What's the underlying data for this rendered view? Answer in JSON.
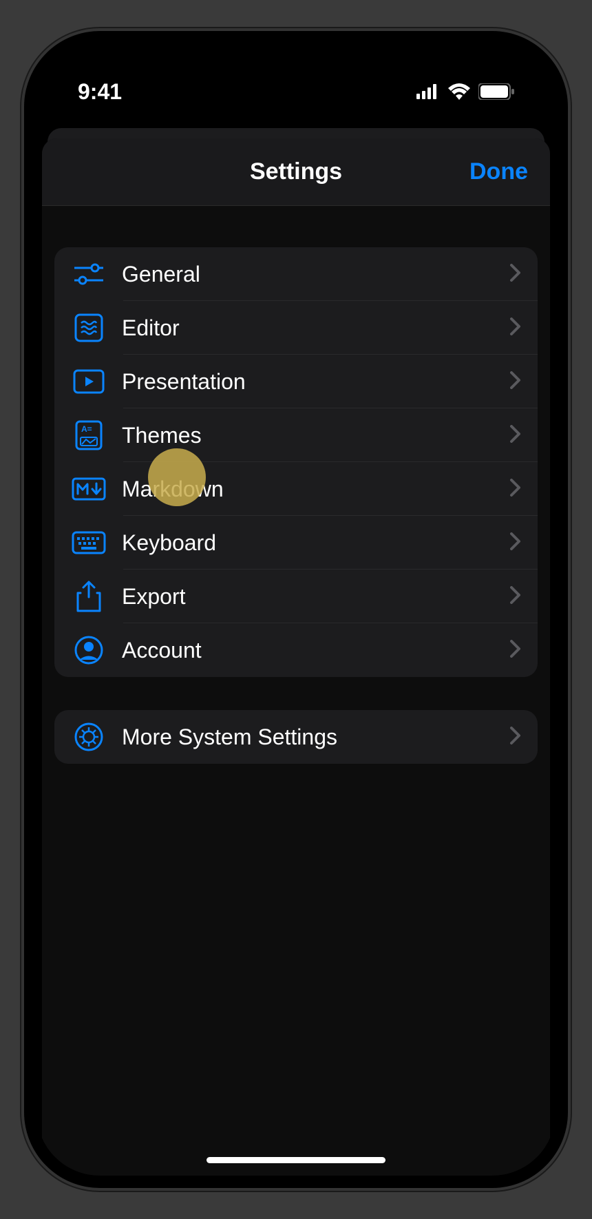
{
  "status": {
    "time": "9:41"
  },
  "nav": {
    "title": "Settings",
    "done": "Done"
  },
  "group1": [
    {
      "label": "General",
      "icon": "sliders"
    },
    {
      "label": "Editor",
      "icon": "waves"
    },
    {
      "label": "Presentation",
      "icon": "play"
    },
    {
      "label": "Themes",
      "icon": "themes"
    },
    {
      "label": "Markdown",
      "icon": "markdown"
    },
    {
      "label": "Keyboard",
      "icon": "keyboard"
    },
    {
      "label": "Export",
      "icon": "export"
    },
    {
      "label": "Account",
      "icon": "account"
    }
  ],
  "group2": [
    {
      "label": "More System Settings",
      "icon": "gear"
    }
  ],
  "colors": {
    "accent": "#0a84ff"
  }
}
